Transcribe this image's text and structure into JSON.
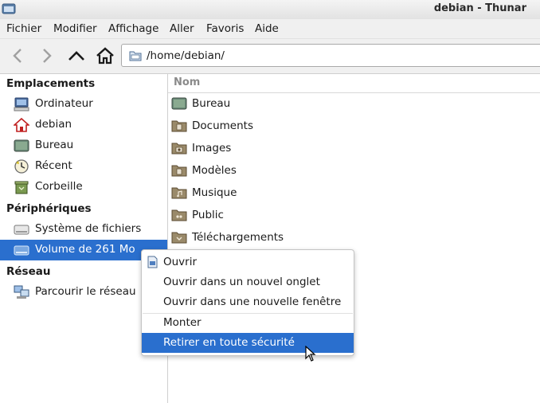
{
  "window": {
    "title": "debian - Thunar"
  },
  "menubar": [
    "Fichier",
    "Modifier",
    "Affichage",
    "Aller",
    "Favoris",
    "Aide"
  ],
  "toolbar": {
    "back_icon": "arrow-left-icon",
    "forward_icon": "arrow-right-icon",
    "up_icon": "arrow-up-icon",
    "home_icon": "home-icon",
    "location": "/home/debian/"
  },
  "sidebar": {
    "sections": [
      {
        "title": "Emplacements",
        "items": [
          {
            "label": "Ordinateur",
            "icon": "computer-icon"
          },
          {
            "label": "debian",
            "icon": "home-folder-icon"
          },
          {
            "label": "Bureau",
            "icon": "desktop-icon"
          },
          {
            "label": "Récent",
            "icon": "recent-clock-icon"
          },
          {
            "label": "Corbeille",
            "icon": "trash-icon"
          }
        ]
      },
      {
        "title": "Périphériques",
        "items": [
          {
            "label": "Système de fichiers",
            "icon": "drive-icon"
          },
          {
            "label": "Volume de 261 Mo",
            "icon": "drive-icon",
            "selected": true
          }
        ]
      },
      {
        "title": "Réseau",
        "items": [
          {
            "label": "Parcourir le réseau",
            "icon": "network-icon"
          }
        ]
      }
    ]
  },
  "file_list": {
    "column_header": "Nom",
    "items": [
      {
        "name": "Bureau",
        "icon": "desktop-icon"
      },
      {
        "name": "Documents",
        "icon": "folder-documents-icon"
      },
      {
        "name": "Images",
        "icon": "folder-pictures-icon"
      },
      {
        "name": "Modèles",
        "icon": "folder-templates-icon"
      },
      {
        "name": "Musique",
        "icon": "folder-music-icon"
      },
      {
        "name": "Public",
        "icon": "folder-public-icon"
      },
      {
        "name": "Téléchargements",
        "icon": "folder-download-icon"
      }
    ]
  },
  "context_menu": {
    "items": [
      {
        "label": "Ouvrir",
        "icon": "open-icon"
      },
      {
        "label": "Ouvrir dans un nouvel onglet"
      },
      {
        "label": "Ouvrir dans une nouvelle fenêtre"
      },
      {
        "label": "Monter"
      },
      {
        "label": "Retirer en toute sécurité",
        "highlighted": true
      }
    ]
  },
  "colors": {
    "selection": "#2a6fce",
    "folder": "#9a8a6a"
  }
}
